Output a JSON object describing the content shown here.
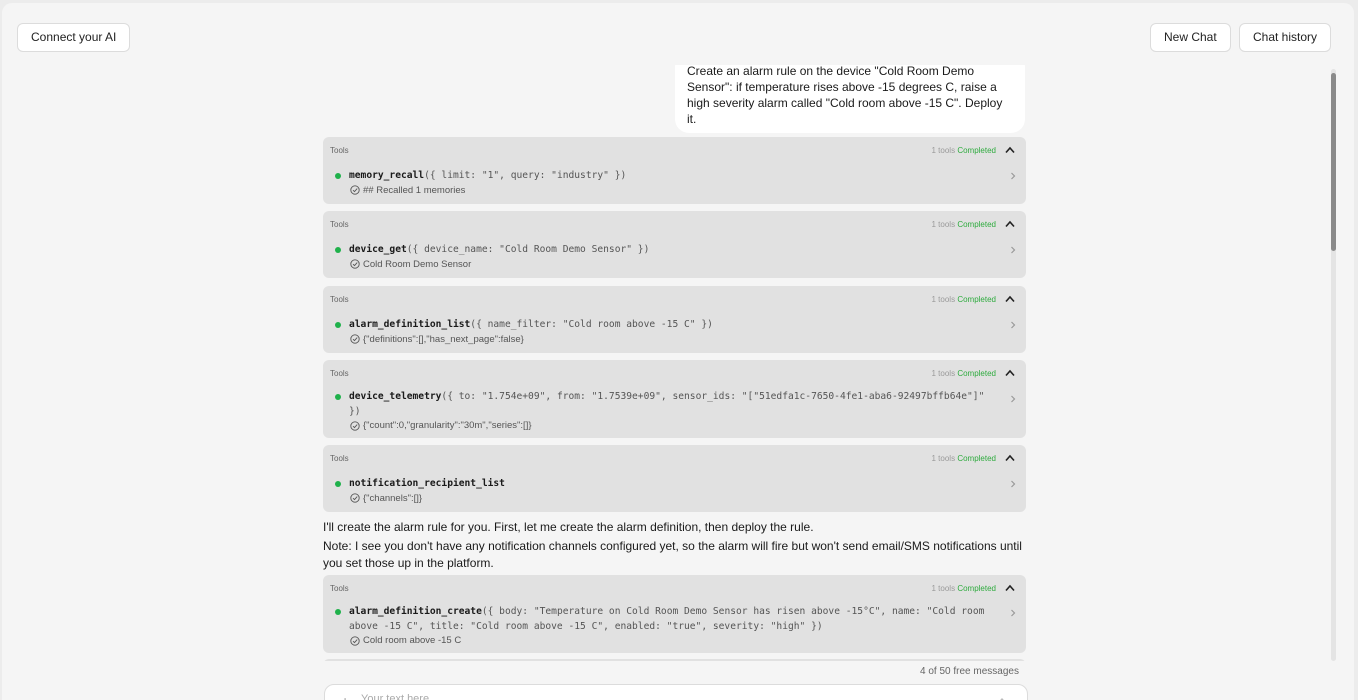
{
  "header": {
    "connect_label": "Connect your AI",
    "new_chat_label": "New Chat",
    "history_label": "Chat history"
  },
  "user_message": "Create an alarm rule on the device \"Cold Room Demo Sensor\": if temperature rises above -15 degrees C, raise a high severity alarm called \"Cold room above -15 C\". Deploy it.",
  "tools_label": "Tools",
  "tool_count_label": "1 tools",
  "completed_label": "Completed",
  "tool_cards": [
    {
      "fn": "memory_recall",
      "args": "({ limit: \"1\", query: \"industry\" })",
      "result": "## Recalled 1 memories"
    },
    {
      "fn": "device_get",
      "args": "({ device_name: \"Cold Room Demo Sensor\" })",
      "result": "Cold Room Demo Sensor"
    },
    {
      "fn": "alarm_definition_list",
      "args": "({ name_filter: \"Cold room above -15 C\" })",
      "result": "{\"definitions\":[],\"has_next_page\":false}"
    },
    {
      "fn": "device_telemetry",
      "args": "({ to: \"1.754e+09\", from: \"1.7539e+09\", sensor_ids: \"[\"51edfa1c-7650-4fe1-aba6-92497bffb64e\"]\" })",
      "result": "{\"count\":0,\"granularity\":\"30m\",\"series\":[]}"
    },
    {
      "fn": "notification_recipient_list",
      "args": "",
      "result": "{\"channels\":[]}"
    },
    {
      "fn": "alarm_definition_create",
      "args": "({ body: \"Temperature on Cold Room Demo Sensor has risen above -15°C\", name: \"Cold room above -15 C\", title: \"Cold room above -15 C\", enabled: \"true\", severity: \"high\" })",
      "result": "Cold room above -15 C"
    }
  ],
  "assistant": {
    "line1": "I'll create the alarm rule for you. First, let me create the alarm definition, then deploy the rule.",
    "line2": "Note: I see you don't have any notification channels configured yet, so the alarm will fire but won't send email/SMS notifications until you set those up in the platform."
  },
  "footer": {
    "counter": "4 of 50 free messages",
    "placeholder": "Your text here"
  },
  "colors": {
    "success": "#2eab3e",
    "dot": "#1fb14b",
    "card_bg": "#e1e1e1",
    "page_bg": "#f5f5f5"
  }
}
